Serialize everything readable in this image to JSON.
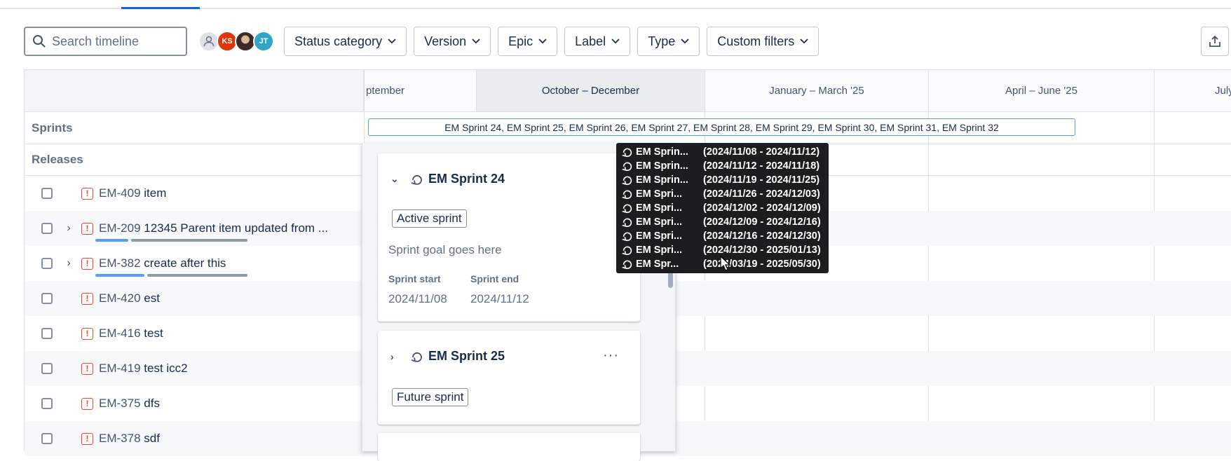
{
  "toolbar": {
    "search_placeholder": "Search timeline",
    "avatars": [
      {
        "initials": "",
        "type": "unassigned",
        "color": "#dfe1e6"
      },
      {
        "initials": "KS",
        "type": "initials",
        "color": "#de350b"
      },
      {
        "initials": "",
        "type": "photo",
        "color": "#3a2c24"
      },
      {
        "initials": "JT",
        "type": "initials",
        "color": "#2fa5c7"
      }
    ],
    "filters": [
      "Status category",
      "Version",
      "Epic",
      "Label",
      "Type",
      "Custom filters"
    ],
    "share_icon": "export-icon"
  },
  "timeline": {
    "columns": [
      "ptember",
      "October – December",
      "January – March '25",
      "April – June '25",
      "July"
    ],
    "current_column": "October – December",
    "sections": {
      "sprints": "Sprints",
      "releases": "Releases"
    },
    "sprint_strip": "EM Sprint 24, EM Sprint 25, EM Sprint 26, EM Sprint 27, EM Sprint 28, EM Sprint 29, EM Sprint 30, EM Sprint 31, EM Sprint 32"
  },
  "issues": [
    {
      "key": "EM-409",
      "title": "item",
      "expandable": false
    },
    {
      "key": "EM-209",
      "title": "12345 Parent item updated from ...",
      "expandable": true,
      "progress": {
        "done": 0.3,
        "color_done": "#579dff",
        "color_rest": "#8c9bab"
      }
    },
    {
      "key": "EM-382",
      "title": "create after this",
      "expandable": true,
      "progress": {
        "done": 0.35,
        "color_done": "#579dff",
        "color_rest": "#8c9bab"
      }
    },
    {
      "key": "EM-420",
      "title": "est",
      "expandable": false
    },
    {
      "key": "EM-416",
      "title": "test",
      "expandable": false
    },
    {
      "key": "EM-419",
      "title": "test icc2",
      "expandable": false
    },
    {
      "key": "EM-375",
      "title": "dfs",
      "expandable": false
    },
    {
      "key": "EM-378",
      "title": "sdf",
      "expandable": false
    }
  ],
  "sprint_panel": {
    "cards": [
      {
        "name": "EM Sprint 24",
        "expanded": true,
        "status": "Active sprint",
        "goal": "Sprint goal goes here",
        "start_label": "Sprint start",
        "end_label": "Sprint end",
        "start": "2024/11/08",
        "end": "2024/11/12"
      },
      {
        "name": "EM Sprint 25",
        "expanded": false,
        "status": "Future sprint",
        "more": "···"
      }
    ]
  },
  "tooltip": [
    {
      "name": "EM Sprin...",
      "range": "(2024/11/08 - 2024/11/12)"
    },
    {
      "name": "EM Sprin...",
      "range": "(2024/11/12 - 2024/11/18)"
    },
    {
      "name": "EM Sprin...",
      "range": "(2024/11/19 - 2024/11/25)"
    },
    {
      "name": "EM Spri...",
      "range": "(2024/11/26 - 2024/12/03)"
    },
    {
      "name": "EM Spri...",
      "range": "(2024/12/02 - 2024/12/09)"
    },
    {
      "name": "EM Spri...",
      "range": "(2024/12/09 - 2024/12/16)"
    },
    {
      "name": "EM Spri...",
      "range": "(2024/12/16 - 2024/12/30)"
    },
    {
      "name": "EM Spri...",
      "range": "(2024/12/30 - 2025/01/13)"
    },
    {
      "name": "EM Spr...",
      "range": "(2024/03/19 - 2025/05/30)"
    }
  ]
}
